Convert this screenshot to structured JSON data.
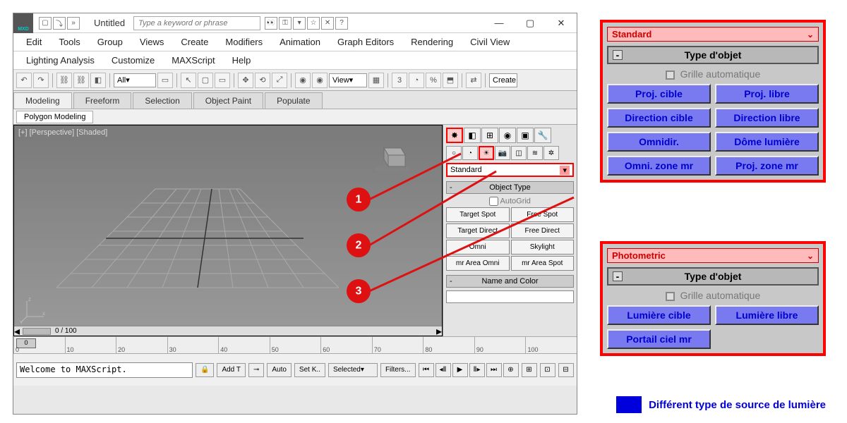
{
  "logo_text": "MXD",
  "title": "Untitled",
  "search_placeholder": "Type a keyword or phrase",
  "menus": [
    "Edit",
    "Tools",
    "Group",
    "Views",
    "Create",
    "Modifiers",
    "Animation",
    "Graph Editors",
    "Rendering",
    "Civil View"
  ],
  "menus2": [
    "Lighting Analysis",
    "Customize",
    "MAXScript",
    "Help"
  ],
  "toolbar": {
    "filter": "All",
    "view": "View",
    "create_label": "Create"
  },
  "ribbon": {
    "tabs": [
      "Modeling",
      "Freeform",
      "Selection",
      "Object Paint",
      "Populate"
    ],
    "subtab": "Polygon Modeling"
  },
  "viewport": {
    "label": "[+] [Perspective] [Shaded]",
    "frame": "0 / 100",
    "timeline_cur": "0"
  },
  "timeline_ticks": [
    "0",
    "10",
    "20",
    "30",
    "40",
    "50",
    "60",
    "70",
    "80",
    "90",
    "100"
  ],
  "status": {
    "maxscript": "Welcome to MAXScript.",
    "add": "Add T",
    "auto": "Auto",
    "setk": "Set K..",
    "selected": "Selected",
    "filters": "Filters..."
  },
  "cmd": {
    "dropdown": "Standard",
    "object_type_title": "Object Type",
    "autogrid": "AutoGrid",
    "buttons": [
      "Target Spot",
      "Free Spot",
      "Target Direct",
      "Free Direct",
      "Omni",
      "Skylight",
      "mr Area Omni",
      "mr Area Spot"
    ],
    "name_title": "Name and Color"
  },
  "callouts": [
    "1",
    "2",
    "3"
  ],
  "popout_standard": {
    "title": "Standard",
    "rollout": "Type d'objet",
    "autogrid": "Grille automatique",
    "buttons": [
      "Proj. cible",
      "Proj. libre",
      "Direction cible",
      "Direction libre",
      "Omnidir.",
      "Dôme lumière",
      "Omni. zone mr",
      "Proj. zone mr"
    ]
  },
  "popout_photometric": {
    "title": "Photometric",
    "rollout": "Type d'objet",
    "autogrid": "Grille automatique",
    "buttons": [
      "Lumière cible",
      "Lumière libre",
      "Portail ciel mr"
    ]
  },
  "legend": "Différent type de source de lumière"
}
